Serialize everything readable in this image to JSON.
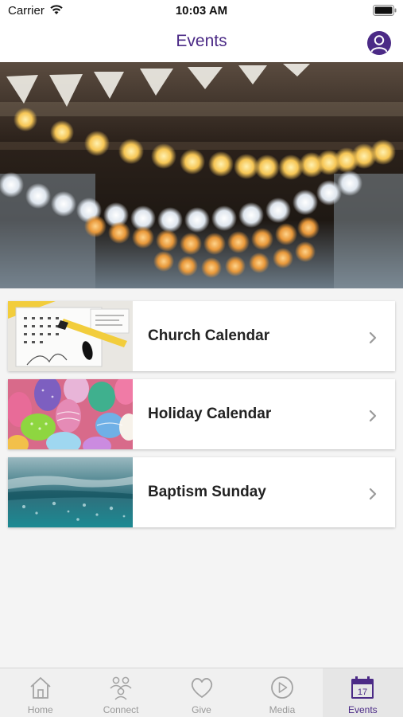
{
  "status_bar": {
    "carrier": "Carrier",
    "time": "10:03 AM"
  },
  "header": {
    "title": "Events"
  },
  "events": [
    {
      "title": "Church Calendar"
    },
    {
      "title": "Holiday Calendar"
    },
    {
      "title": "Baptism Sunday"
    }
  ],
  "tab_bar": {
    "tabs": [
      {
        "label": "Home",
        "icon": "home-icon"
      },
      {
        "label": "Connect",
        "icon": "connect-icon"
      },
      {
        "label": "Give",
        "icon": "heart-icon"
      },
      {
        "label": "Media",
        "icon": "play-icon"
      },
      {
        "label": "Events",
        "icon": "calendar-icon",
        "badge": "17",
        "active": true
      }
    ]
  },
  "colors": {
    "accent": "#4b2a86",
    "inactive": "#999999",
    "background": "#f4f4f4"
  }
}
